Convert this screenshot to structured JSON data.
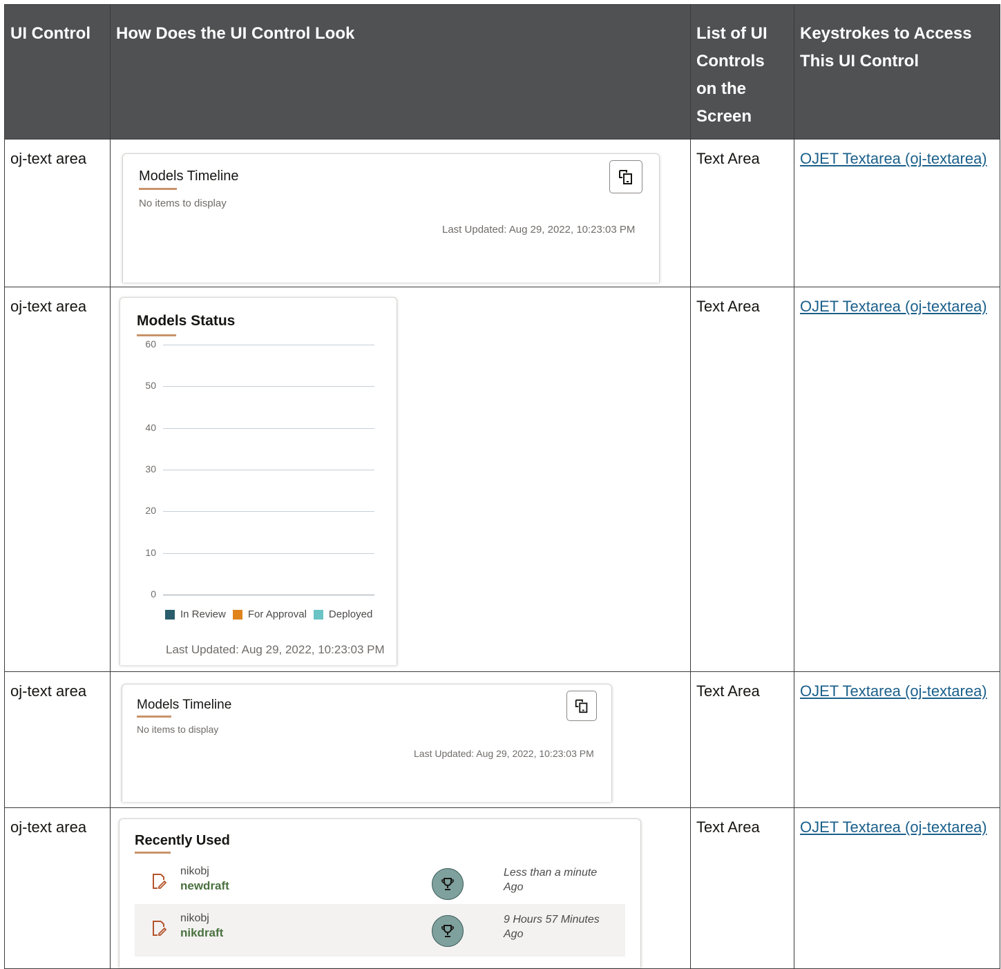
{
  "headers": {
    "col1": "UI Control",
    "col2": "How Does the UI Control Look",
    "col3": "List of UI Controls on the Screen",
    "col4": "Keystrokes to Access This UI Control"
  },
  "rows": [
    {
      "control": "oj-text area",
      "list": "Text Area",
      "link": "OJET Textarea (oj-textarea)"
    },
    {
      "control": "oj-text area",
      "list": "Text Area",
      "link": "OJET Textarea (oj-textarea)"
    },
    {
      "control": "oj-text area",
      "list": "Text Area",
      "link": "OJET Textarea (oj-textarea)"
    },
    {
      "control": "oj-text area",
      "list": "Text Area",
      "link": "OJET Textarea (oj-textarea)"
    }
  ],
  "timeline1": {
    "title": "Models Timeline",
    "empty": "No items to display",
    "updated": "Last Updated: Aug 29, 2022, 10:23:03 PM",
    "icon": "switch-view-icon"
  },
  "status": {
    "title": "Models Status",
    "updated": "Last Updated: Aug 29, 2022, 10:23:03 PM"
  },
  "timeline2": {
    "title": "Models Timeline",
    "empty": "No items to display",
    "updated": "Last Updated: Aug 29, 2022, 10:23:03 PM",
    "icon": "switch-view-icon"
  },
  "recent": {
    "title": "Recently Used",
    "items": [
      {
        "user": "nikobj",
        "name": "newdraft",
        "time": "Less than a minute Ago",
        "icon": "edit-document-icon",
        "badge": "trophy-icon"
      },
      {
        "user": "nikobj",
        "name": "nikdraft",
        "time": "9 Hours 57 Minutes Ago",
        "icon": "edit-document-icon",
        "badge": "trophy-icon"
      }
    ]
  },
  "chart_data": {
    "type": "bar",
    "title": "Models Status",
    "categories": [],
    "series": [
      {
        "name": "In Review",
        "values": [],
        "color": "#2a5d6b"
      },
      {
        "name": "For Approval",
        "values": [],
        "color": "#e0831c"
      },
      {
        "name": "Deployed",
        "values": [],
        "color": "#6ac3c4"
      }
    ],
    "yticks": [
      "60",
      "50",
      "40",
      "30",
      "20",
      "10",
      "0"
    ],
    "ylim": [
      0,
      60
    ],
    "grid": true,
    "legend": "bottom"
  },
  "colors": {
    "header_bg": "#505153",
    "accent_underline": "#c9936a",
    "link": "#1a5f8a",
    "draft_name": "#4a7140"
  }
}
